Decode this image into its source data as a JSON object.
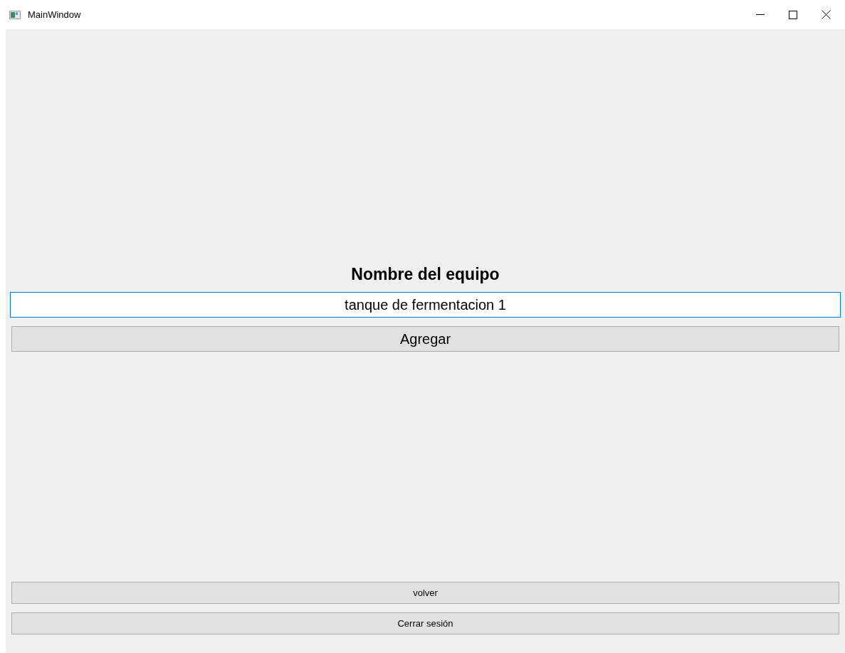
{
  "window": {
    "title": "MainWindow"
  },
  "form": {
    "heading": "Nombre del equipo",
    "name_field": {
      "value": "tanque de fermentacion 1",
      "focused": true
    },
    "add_button": "Agregar"
  },
  "footer_buttons": [
    "volver",
    "Cerrar sesión"
  ]
}
